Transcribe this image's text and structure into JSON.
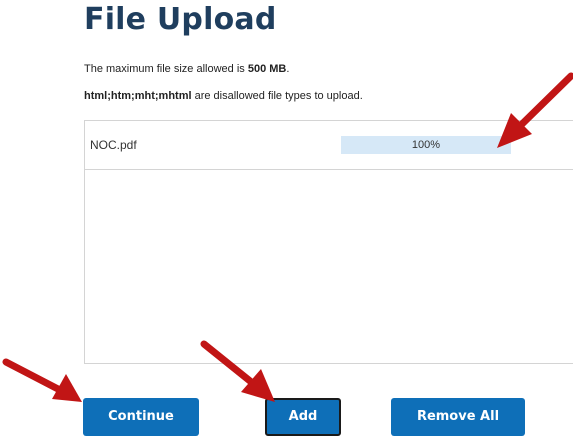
{
  "page": {
    "title": "File Upload",
    "max_size_prefix": "The maximum file size allowed is ",
    "max_size_value": "500 MB",
    "max_size_suffix": ".",
    "disallowed_types": "html;htm;mht;mhtml",
    "disallowed_suffix": " are disallowed file types to upload."
  },
  "files": [
    {
      "name": "NOC.pdf",
      "progress_label": "100%",
      "progress_fraction": 1.0
    }
  ],
  "buttons": {
    "continue_label": "Continue",
    "add_label": "Add",
    "remove_all_label": "Remove All"
  },
  "colors": {
    "title": "#1f3e5e",
    "button": "#0e6fb8",
    "progress_fill": "#d6e8f7",
    "annotation_arrow": "#c11515"
  }
}
